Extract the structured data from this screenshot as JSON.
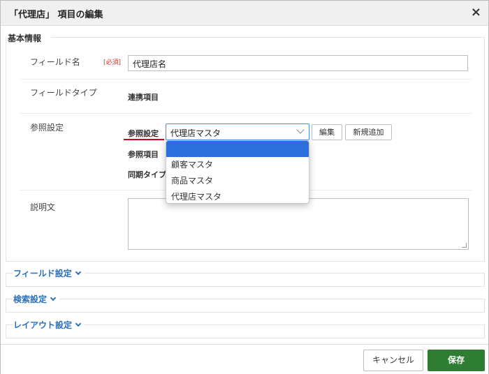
{
  "dialog": {
    "title": "「代理店」 項目の編集",
    "close_glyph": "×"
  },
  "basic": {
    "legend": "基本情報",
    "field_name_label": "フィールド名",
    "required_badge": "[必須]",
    "field_name_value": "代理店名",
    "field_type_label": "フィールドタイプ",
    "field_type_value": "連携項目",
    "reference_label": "参照設定",
    "ref_setting_label": "参照設定",
    "ref_item_label": "参照項目",
    "sync_type_label": "同期タイプ",
    "ref_select_value": "代理店マスタ",
    "edit_button": "編集",
    "new_button": "新規追加",
    "description_label": "説明文"
  },
  "dropdown": {
    "options": [
      "",
      "顧客マスタ",
      "商品マスタ",
      "代理店マスタ"
    ]
  },
  "sections": {
    "field_settings": "フィールド設定",
    "search_settings": "検索設定",
    "layout_settings": "レイアウト設定"
  },
  "footer": {
    "cancel": "キャンセル",
    "save": "保存"
  },
  "colors": {
    "accent_blue": "#2a6fdb",
    "save_green": "#2e7d32",
    "required_red": "#c0392b",
    "highlight_red": "#d0021b"
  }
}
